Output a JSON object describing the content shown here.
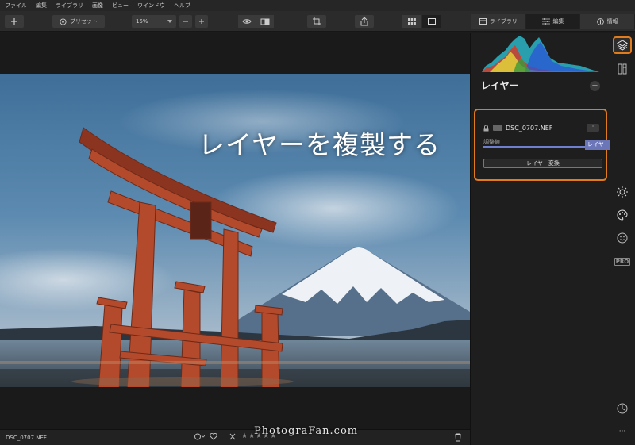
{
  "menu": {
    "items": [
      "ファイル",
      "編集",
      "ライブラリ",
      "画像",
      "ビュー",
      "ウインドウ",
      "ヘルプ"
    ]
  },
  "toolbar": {
    "presets_label": "プリセット",
    "zoom_value": "15%",
    "tabs": [
      {
        "label": "ライブラリ",
        "icon": "library-icon"
      },
      {
        "label": "編集",
        "icon": "sliders-icon"
      },
      {
        "label": "情報",
        "icon": "info-icon"
      }
    ],
    "active_tab": "編集"
  },
  "workspace": {
    "overlay_caption": "レイヤーを複製する"
  },
  "status": {
    "filename": "DSC_0707.NEF",
    "stars": "★★★★★",
    "watermark": "PhotograFan.com"
  },
  "panel": {
    "layers_title": "レイヤー",
    "add_symbol": "+",
    "layer": {
      "name": "DSC_0707.NEF",
      "more": "···",
      "opacity_label": "調整値",
      "convert_button": "レイヤー変換"
    },
    "tooltip": "レイヤーを複製"
  },
  "rail": {
    "items": [
      "layers-icon",
      "crop-info-icon",
      "essentials-sun-icon",
      "creative-palette-icon",
      "portrait-face-icon",
      "pro-icon",
      "history-clock-icon",
      "more-icon"
    ],
    "pro_label": "PRO",
    "more_label": "···"
  },
  "colors": {
    "accent_orange": "#e07b1e",
    "slider_blue": "#6e7fd0",
    "tooltip_bg": "#6b76b8"
  }
}
